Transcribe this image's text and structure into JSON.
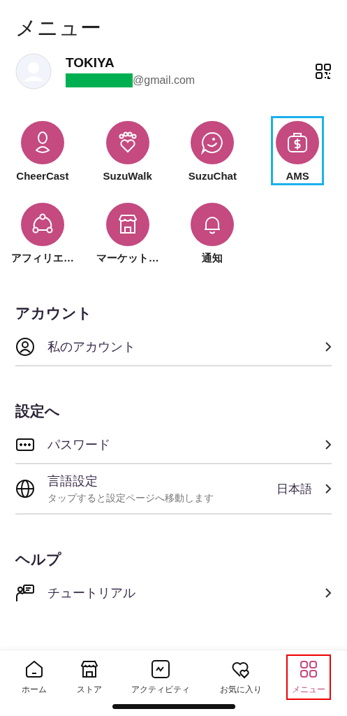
{
  "title": "メニュー",
  "profile": {
    "name": "TOKIYA",
    "email": "@gmail.com",
    "email_redacted": true
  },
  "apps": [
    {
      "label": "CheerCast",
      "highlighted": false
    },
    {
      "label": "SuzuWalk",
      "highlighted": false
    },
    {
      "label": "SuzuChat",
      "highlighted": false
    },
    {
      "label": "AMS",
      "highlighted": true
    },
    {
      "label": "アフィリエ…",
      "highlighted": false
    },
    {
      "label": "マーケット…",
      "highlighted": false
    },
    {
      "label": "通知",
      "highlighted": false
    }
  ],
  "sections": [
    {
      "heading": "アカウント",
      "rows": [
        {
          "label": "私のアカウント",
          "divider": true
        }
      ]
    },
    {
      "heading": "設定へ",
      "rows": [
        {
          "label": "パスワード",
          "divider": true
        },
        {
          "label": "言語設定",
          "value": "日本語",
          "subtitle": "タップすると設定ページへ移動します",
          "divider": true
        }
      ]
    },
    {
      "heading": "ヘルプ",
      "rows": [
        {
          "label": "チュートリアル",
          "divider": false
        }
      ]
    }
  ],
  "nav": [
    {
      "label": "ホーム",
      "selected": false,
      "highlighted": false
    },
    {
      "label": "ストア",
      "selected": false,
      "highlighted": false
    },
    {
      "label": "アクティビティ",
      "selected": false,
      "highlighted": false
    },
    {
      "label": "お気に入り",
      "selected": false,
      "highlighted": false
    },
    {
      "label": "メニュー",
      "selected": true,
      "highlighted": true
    }
  ]
}
